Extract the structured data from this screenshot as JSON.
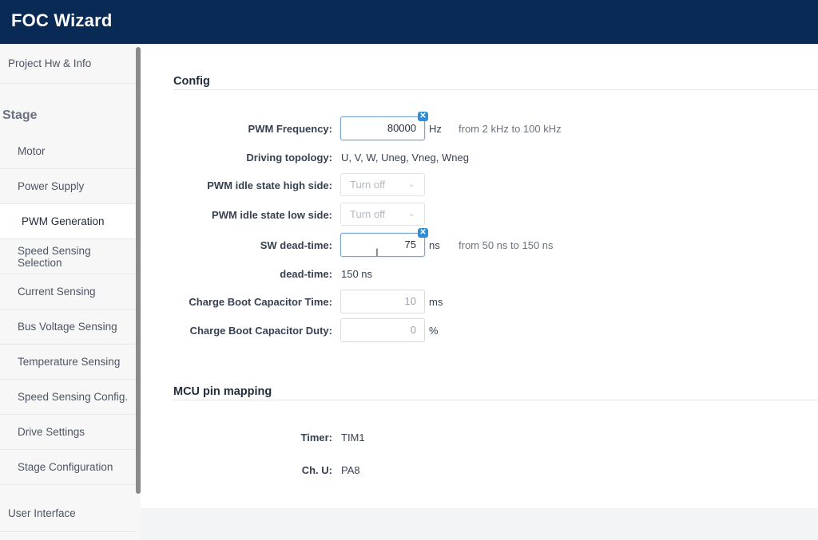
{
  "app": {
    "title": "FOC Wizard"
  },
  "sidebar": {
    "project": "Project Hw & Info",
    "stage_heading": "Stage",
    "items": [
      {
        "label": "Motor"
      },
      {
        "label": "Power Supply"
      },
      {
        "label": "PWM Generation"
      },
      {
        "label": "Speed Sensing Selection"
      },
      {
        "label": "Current Sensing"
      },
      {
        "label": "Bus Voltage Sensing"
      },
      {
        "label": "Temperature Sensing"
      },
      {
        "label": "Speed Sensing Config."
      },
      {
        "label": "Drive Settings"
      },
      {
        "label": "Stage Configuration"
      }
    ],
    "active_item": "PWM Generation",
    "user_interface": "User Interface"
  },
  "config": {
    "title": "Config",
    "pwm_frequency": {
      "label": "PWM Frequency:",
      "value": "80000",
      "unit": "Hz",
      "hint": "from 2 kHz to 100 kHz"
    },
    "driving_topology": {
      "label": "Driving topology:",
      "value": "U, V, W, Uneg, Vneg, Wneg"
    },
    "pwm_idle_high": {
      "label": "PWM idle state high side:",
      "value": "Turn off"
    },
    "pwm_idle_low": {
      "label": "PWM idle state low side:",
      "value": "Turn off"
    },
    "sw_dead_time": {
      "label": "SW dead-time:",
      "value": "75",
      "unit": "ns",
      "hint": "from 50 ns to 150 ns"
    },
    "dead_time": {
      "label": "dead-time:",
      "value": "150 ns"
    },
    "charge_boot_time": {
      "label": "Charge Boot Capacitor Time:",
      "value": "10",
      "unit": "ms"
    },
    "charge_boot_duty": {
      "label": "Charge Boot Capacitor Duty:",
      "value": "0",
      "unit": "%"
    }
  },
  "mcu": {
    "title": "MCU pin mapping",
    "timer": {
      "label": "Timer:",
      "value": "TIM1"
    },
    "ch_u": {
      "label": "Ch. U:",
      "value": "PA8"
    }
  },
  "icons": {
    "clear": "clear-x-icon",
    "chevron": "chevron-down-icon",
    "cursor": "text-cursor-icon"
  }
}
